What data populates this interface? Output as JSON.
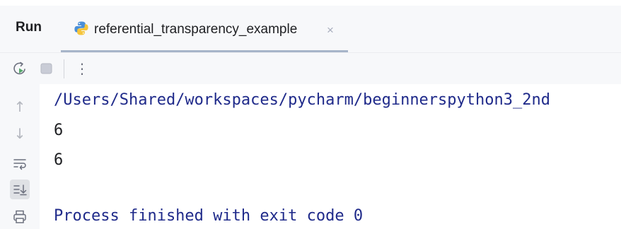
{
  "colors": {
    "accent_underline": "#a7b5c9",
    "console_text_system": "#1f2a8a",
    "console_text_output": "#1e1f22",
    "panel_background": "#f7f8fa"
  },
  "header": {
    "run_label": "Run",
    "tab": {
      "label": "referential_transparency_example",
      "icon": "python-icon",
      "close_symbol": "×"
    }
  },
  "toolbar": {
    "icons": [
      "rerun-icon",
      "stop-icon",
      "more-options-icon"
    ],
    "more_symbol": "⋮"
  },
  "gutter": {
    "icons": [
      "scroll-up-icon",
      "scroll-down-icon",
      "soft-wrap-icon",
      "scroll-to-end-icon",
      "print-icon"
    ],
    "up_symbol": "↑",
    "down_symbol": "↓"
  },
  "console": {
    "lines": [
      "/Users/Shared/workspaces/pycharm/beginnerspython3_2nd",
      "6",
      "6",
      "",
      "Process finished with exit code 0"
    ]
  }
}
